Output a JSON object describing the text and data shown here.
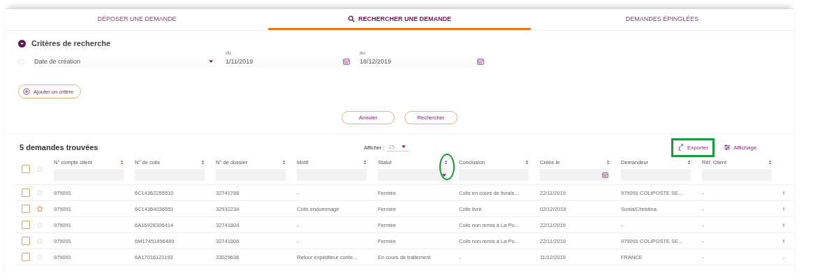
{
  "tabs": [
    {
      "label": "DÉPOSER UNE DEMANDE",
      "selected": false,
      "kind": "plain"
    },
    {
      "label": "RECHERCHER UNE DEMANDE",
      "selected": true,
      "kind": "search"
    },
    {
      "label": "DEMANDES ÉPINGLÉES",
      "selected": false,
      "kind": "plain"
    }
  ],
  "criteria": {
    "title": "Critères de recherche",
    "expanded": true,
    "field": {
      "value": "Date de création"
    },
    "from": {
      "label": "du",
      "value": "1/11/2019"
    },
    "to": {
      "label": "au",
      "value": "18/12/2019"
    },
    "add_button": "Ajouter un critère"
  },
  "actions": [
    "Annuler",
    "Rechercher"
  ],
  "results": {
    "title": "5 demandes trouvées",
    "page_size_label": "Afficher :",
    "page_size": "25",
    "export": {
      "label": "Exporter",
      "highlighted": true
    },
    "display": {
      "label": "Affichage"
    }
  },
  "table": {
    "all_checked": false,
    "columns": [
      {
        "label": "N° compte client",
        "kind": "text",
        "highlighted": false
      },
      {
        "label": "N° de colis",
        "kind": "text",
        "highlighted": false
      },
      {
        "label": "N° de dossier",
        "kind": "text",
        "highlighted": false
      },
      {
        "label": "Motif",
        "kind": "text",
        "highlighted": false
      },
      {
        "label": "Statut",
        "kind": "select",
        "highlighted": true
      },
      {
        "label": "Conclusion",
        "kind": "text",
        "highlighted": false
      },
      {
        "label": "Créée le",
        "kind": "date",
        "highlighted": false
      },
      {
        "label": "Demandeur",
        "kind": "text",
        "highlighted": false
      },
      {
        "label": "Réf. Client",
        "kind": "text",
        "highlighted": false
      }
    ],
    "rows": [
      {
        "checked": false,
        "pinned": false,
        "cells": [
          "979091",
          "6C14362255510",
          "32741786",
          "-",
          "Fermée",
          "Colis en cours de livrais...",
          "22/11/2019",
          "979091 COLIPOSTE SE...",
          "-",
          "f"
        ]
      },
      {
        "checked": false,
        "pinned": true,
        "cells": [
          "979091",
          "6C14364036551",
          "32932234",
          "Colis endommagé",
          "Fermée",
          "Colis livré",
          "02/12/2019",
          "Sonia/Christina",
          "-",
          "f"
        ]
      },
      {
        "checked": false,
        "pinned": false,
        "cells": [
          "979091",
          "6A16928306414",
          "32741804",
          "-",
          "Fermée",
          "Colis non remis à La Po...",
          "22/11/2019",
          "-",
          "-",
          "f"
        ]
      },
      {
        "checked": false,
        "pinned": false,
        "cells": [
          "979091",
          "6M17451896489",
          "32741806",
          "-",
          "Fermée",
          "Colis non remis à La Po...",
          "22/11/2019",
          "979091 COLIPOSTE SE...",
          "-",
          "f"
        ]
      },
      {
        "checked": false,
        "pinned": false,
        "cells": [
          "979091",
          "6A17016121193",
          "33029636",
          "Retour expéditeur conte...",
          "En cours de traitement",
          "-",
          "11/12/2019",
          "FRANCE",
          "-",
          "-"
        ]
      }
    ]
  }
}
